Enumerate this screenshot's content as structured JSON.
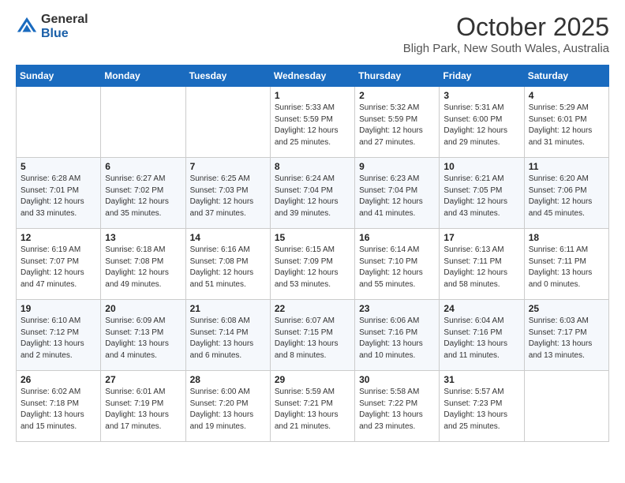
{
  "logo": {
    "general": "General",
    "blue": "Blue"
  },
  "title": "October 2025",
  "location": "Bligh Park, New South Wales, Australia",
  "days_of_week": [
    "Sunday",
    "Monday",
    "Tuesday",
    "Wednesday",
    "Thursday",
    "Friday",
    "Saturday"
  ],
  "weeks": [
    [
      {
        "day": "",
        "info": ""
      },
      {
        "day": "",
        "info": ""
      },
      {
        "day": "",
        "info": ""
      },
      {
        "day": "1",
        "info": "Sunrise: 5:33 AM\nSunset: 5:59 PM\nDaylight: 12 hours\nand 25 minutes."
      },
      {
        "day": "2",
        "info": "Sunrise: 5:32 AM\nSunset: 5:59 PM\nDaylight: 12 hours\nand 27 minutes."
      },
      {
        "day": "3",
        "info": "Sunrise: 5:31 AM\nSunset: 6:00 PM\nDaylight: 12 hours\nand 29 minutes."
      },
      {
        "day": "4",
        "info": "Sunrise: 5:29 AM\nSunset: 6:01 PM\nDaylight: 12 hours\nand 31 minutes."
      }
    ],
    [
      {
        "day": "5",
        "info": "Sunrise: 6:28 AM\nSunset: 7:01 PM\nDaylight: 12 hours\nand 33 minutes."
      },
      {
        "day": "6",
        "info": "Sunrise: 6:27 AM\nSunset: 7:02 PM\nDaylight: 12 hours\nand 35 minutes."
      },
      {
        "day": "7",
        "info": "Sunrise: 6:25 AM\nSunset: 7:03 PM\nDaylight: 12 hours\nand 37 minutes."
      },
      {
        "day": "8",
        "info": "Sunrise: 6:24 AM\nSunset: 7:04 PM\nDaylight: 12 hours\nand 39 minutes."
      },
      {
        "day": "9",
        "info": "Sunrise: 6:23 AM\nSunset: 7:04 PM\nDaylight: 12 hours\nand 41 minutes."
      },
      {
        "day": "10",
        "info": "Sunrise: 6:21 AM\nSunset: 7:05 PM\nDaylight: 12 hours\nand 43 minutes."
      },
      {
        "day": "11",
        "info": "Sunrise: 6:20 AM\nSunset: 7:06 PM\nDaylight: 12 hours\nand 45 minutes."
      }
    ],
    [
      {
        "day": "12",
        "info": "Sunrise: 6:19 AM\nSunset: 7:07 PM\nDaylight: 12 hours\nand 47 minutes."
      },
      {
        "day": "13",
        "info": "Sunrise: 6:18 AM\nSunset: 7:08 PM\nDaylight: 12 hours\nand 49 minutes."
      },
      {
        "day": "14",
        "info": "Sunrise: 6:16 AM\nSunset: 7:08 PM\nDaylight: 12 hours\nand 51 minutes."
      },
      {
        "day": "15",
        "info": "Sunrise: 6:15 AM\nSunset: 7:09 PM\nDaylight: 12 hours\nand 53 minutes."
      },
      {
        "day": "16",
        "info": "Sunrise: 6:14 AM\nSunset: 7:10 PM\nDaylight: 12 hours\nand 55 minutes."
      },
      {
        "day": "17",
        "info": "Sunrise: 6:13 AM\nSunset: 7:11 PM\nDaylight: 12 hours\nand 58 minutes."
      },
      {
        "day": "18",
        "info": "Sunrise: 6:11 AM\nSunset: 7:11 PM\nDaylight: 13 hours\nand 0 minutes."
      }
    ],
    [
      {
        "day": "19",
        "info": "Sunrise: 6:10 AM\nSunset: 7:12 PM\nDaylight: 13 hours\nand 2 minutes."
      },
      {
        "day": "20",
        "info": "Sunrise: 6:09 AM\nSunset: 7:13 PM\nDaylight: 13 hours\nand 4 minutes."
      },
      {
        "day": "21",
        "info": "Sunrise: 6:08 AM\nSunset: 7:14 PM\nDaylight: 13 hours\nand 6 minutes."
      },
      {
        "day": "22",
        "info": "Sunrise: 6:07 AM\nSunset: 7:15 PM\nDaylight: 13 hours\nand 8 minutes."
      },
      {
        "day": "23",
        "info": "Sunrise: 6:06 AM\nSunset: 7:16 PM\nDaylight: 13 hours\nand 10 minutes."
      },
      {
        "day": "24",
        "info": "Sunrise: 6:04 AM\nSunset: 7:16 PM\nDaylight: 13 hours\nand 11 minutes."
      },
      {
        "day": "25",
        "info": "Sunrise: 6:03 AM\nSunset: 7:17 PM\nDaylight: 13 hours\nand 13 minutes."
      }
    ],
    [
      {
        "day": "26",
        "info": "Sunrise: 6:02 AM\nSunset: 7:18 PM\nDaylight: 13 hours\nand 15 minutes."
      },
      {
        "day": "27",
        "info": "Sunrise: 6:01 AM\nSunset: 7:19 PM\nDaylight: 13 hours\nand 17 minutes."
      },
      {
        "day": "28",
        "info": "Sunrise: 6:00 AM\nSunset: 7:20 PM\nDaylight: 13 hours\nand 19 minutes."
      },
      {
        "day": "29",
        "info": "Sunrise: 5:59 AM\nSunset: 7:21 PM\nDaylight: 13 hours\nand 21 minutes."
      },
      {
        "day": "30",
        "info": "Sunrise: 5:58 AM\nSunset: 7:22 PM\nDaylight: 13 hours\nand 23 minutes."
      },
      {
        "day": "31",
        "info": "Sunrise: 5:57 AM\nSunset: 7:23 PM\nDaylight: 13 hours\nand 25 minutes."
      },
      {
        "day": "",
        "info": ""
      }
    ]
  ]
}
